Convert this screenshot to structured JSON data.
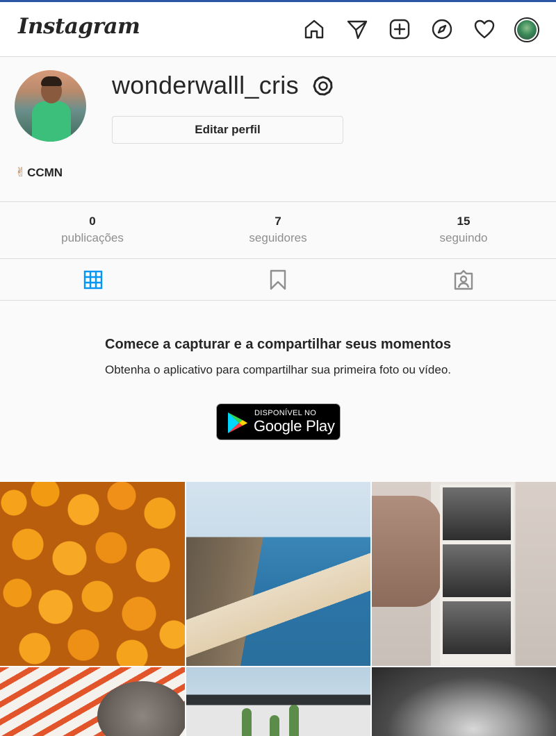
{
  "app": {
    "logo_text": "Instagram"
  },
  "nav": {
    "icons": [
      "home-icon",
      "direct-icon",
      "new-post-icon",
      "explore-icon",
      "activity-icon",
      "profile-avatar"
    ]
  },
  "profile": {
    "username": "wonderwalll_cris",
    "edit_button": "Editar perfil",
    "bio_emoji": "✌",
    "bio": "CCMN"
  },
  "stats": [
    {
      "count": "0",
      "label": "publicações"
    },
    {
      "count": "7",
      "label": "seguidores"
    },
    {
      "count": "15",
      "label": "seguindo"
    }
  ],
  "tabs": {
    "active": "posts",
    "items": [
      "grid-icon",
      "saved-icon",
      "tagged-icon"
    ]
  },
  "empty_state": {
    "title": "Comece a capturar e a compartilhar seus momentos",
    "subtitle": "Obtenha o aplicativo para compartilhar sua primeira foto ou vídeo."
  },
  "google_play": {
    "small_text": "DISPONÍVEL NO",
    "big_text": "Google Play"
  },
  "colors": {
    "accent": "#0095f6",
    "text": "#262626",
    "muted": "#8e8e8e",
    "border": "#dbdbdb",
    "top_stripe": "#2a56a5"
  }
}
